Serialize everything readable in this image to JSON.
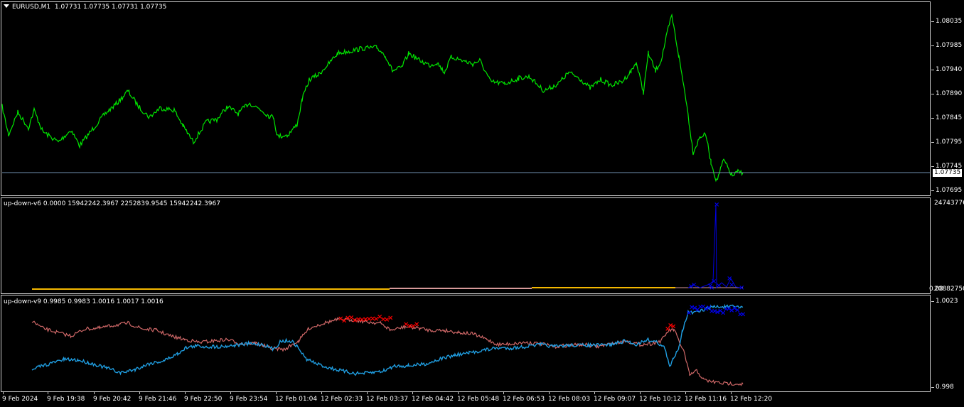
{
  "main": {
    "symbol_label": "EURUSD,M1",
    "ohlc": "1.07731 1.07735 1.07731 1.07735",
    "price_ticks": [
      "1.08035",
      "1.07985",
      "1.07940",
      "1.07890",
      "1.07845",
      "1.07795",
      "1.07745",
      "1.07695"
    ],
    "current_price": "1.07735",
    "colors": {
      "price_line": "#00e600",
      "current_line": "#6f8faf"
    }
  },
  "ind1": {
    "title": "up-down-v6 0.0000 15942242.3967 2252839.9545 15942242.3967",
    "ticks": [
      "24743776",
      "0.00",
      "20882750"
    ],
    "colors": {
      "line": "#0000e0",
      "flat": "#f5b800",
      "pink": "#d89a9a"
    }
  },
  "ind2": {
    "title": "up-down-v9 0.9985 0.9983 1.0016 1.0017 1.0016",
    "ticks": [
      "1.0023",
      "0.998"
    ],
    "colors": {
      "down": "#d06868",
      "up": "#1f9de0",
      "up_mark": "#0000ee",
      "down_mark": "#ff0000"
    }
  },
  "time_axis": [
    "9 Feb 2024",
    "9 Feb 19:38",
    "9 Feb 20:42",
    "9 Feb 21:46",
    "9 Feb 22:50",
    "9 Feb 23:54",
    "12 Feb 01:04",
    "12 Feb 02:33",
    "12 Feb 03:37",
    "12 Feb 04:42",
    "12 Feb 05:48",
    "12 Feb 06:53",
    "12 Feb 08:03",
    "12 Feb 09:07",
    "12 Feb 10:12",
    "12 Feb 11:16",
    "12 Feb 12:20"
  ]
}
